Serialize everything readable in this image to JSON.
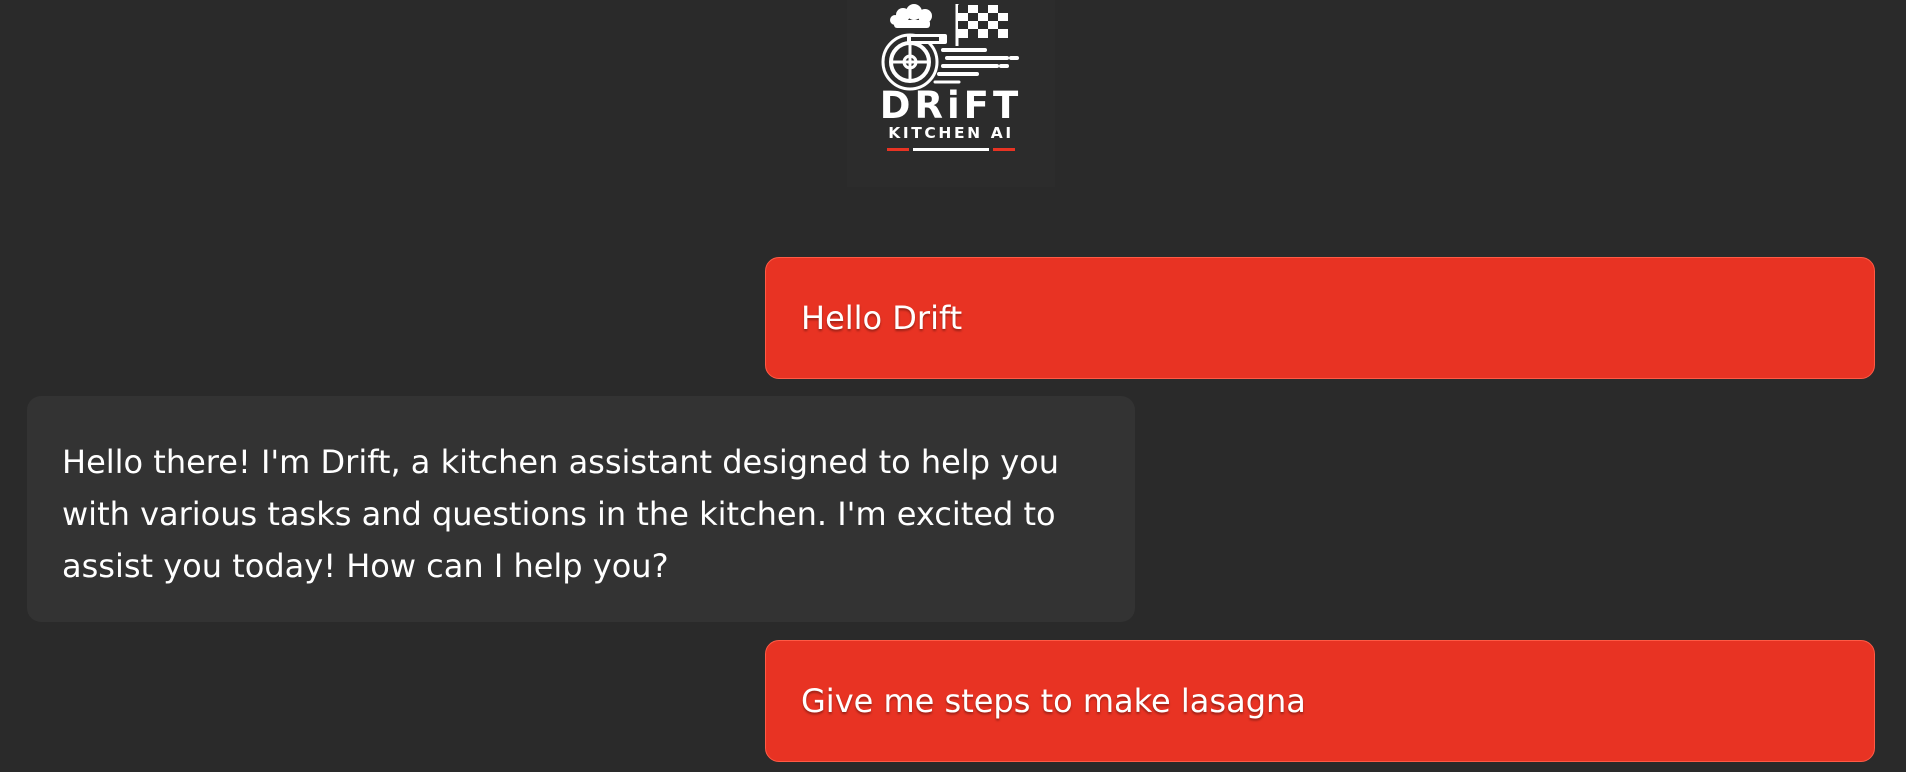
{
  "logo": {
    "title": "DRiFT",
    "subtitle": "KITCHEN AI",
    "icon": "racing-wheel-chef-flag-logo",
    "colors": {
      "accent": "#e83323",
      "text": "#ffffff"
    }
  },
  "chat": {
    "messages": [
      {
        "role": "user",
        "text": "Hello Drift"
      },
      {
        "role": "assistant",
        "text": "Hello there! I'm Drift, a kitchen assistant designed to help you with various tasks and questions in the kitchen. I'm excited to assist you today! How can I help you?"
      },
      {
        "role": "user",
        "text": "Give me steps to make lasagna"
      }
    ]
  },
  "colors": {
    "background": "#2a2a2a",
    "user_bubble": "#e83323",
    "assistant_bubble": "#333333"
  }
}
